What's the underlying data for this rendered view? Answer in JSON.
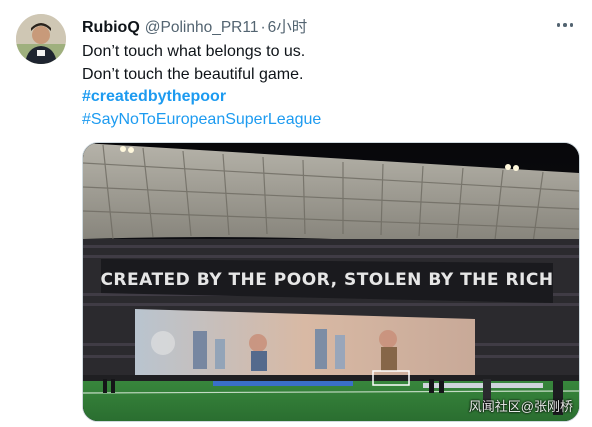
{
  "tweet": {
    "display_name": "RubioQ",
    "handle": "@Polinho_PR11",
    "separator": "·",
    "time": "6小时",
    "lines": [
      "Don’t touch what belongs to us.",
      "Don’t touch the beautiful game."
    ],
    "hashtags": [
      "#createdbythepoor",
      "#SayNoToEuropeanSuperLeague"
    ]
  },
  "media": {
    "banner_text": "CREATED BY THE POOR, STOLEN BY THE RICH",
    "watermark": "风闻社区@张刚桥"
  },
  "icons": {
    "more": "more-horizontal-icon"
  },
  "colors": {
    "link": "#1d9bf0",
    "text": "#0f1419",
    "secondary": "#536471",
    "pitch": "#2d7f3a"
  }
}
